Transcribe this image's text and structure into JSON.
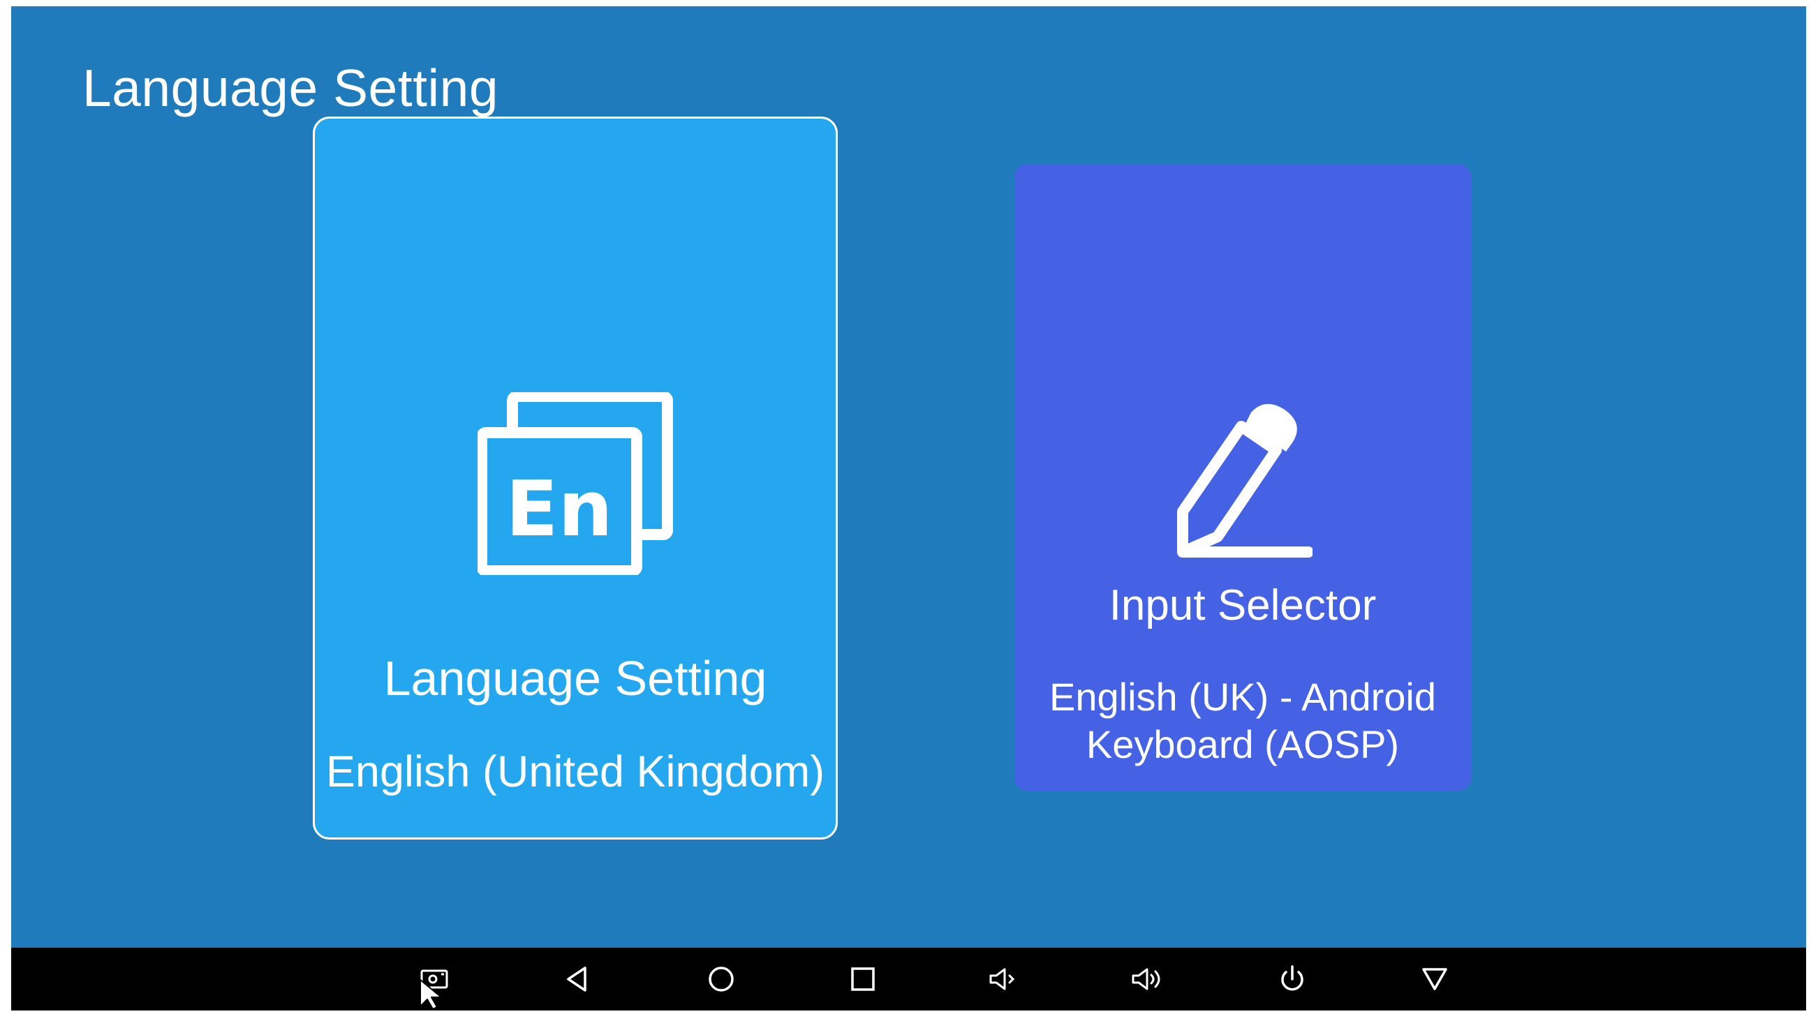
{
  "page": {
    "title": "Language Setting"
  },
  "cards": {
    "language": {
      "icon": "en-language-icon",
      "icon_text": "En",
      "title": "Language Setting",
      "value": "English (United Kingdom)",
      "selected": true
    },
    "input": {
      "icon": "pencil-icon",
      "title": "Input Selector",
      "value": "English (UK) - Android Keyboard (AOSP)",
      "selected": false
    }
  },
  "navbar": {
    "buttons": [
      {
        "name": "screenshot",
        "icon": "screenshot-icon"
      },
      {
        "name": "back",
        "icon": "back-triangle-icon"
      },
      {
        "name": "home",
        "icon": "home-circle-icon"
      },
      {
        "name": "recents",
        "icon": "recents-square-icon"
      },
      {
        "name": "volume-down",
        "icon": "volume-down-icon"
      },
      {
        "name": "volume-up",
        "icon": "volume-up-icon"
      },
      {
        "name": "power",
        "icon": "power-icon"
      },
      {
        "name": "hide-bar",
        "icon": "chevron-down-triangle-icon"
      }
    ]
  },
  "colors": {
    "background": "#1f7bbb",
    "language_card": "#24a7ef",
    "input_card": "#4561e4",
    "navbar": "#000000",
    "text": "#ffffff"
  }
}
